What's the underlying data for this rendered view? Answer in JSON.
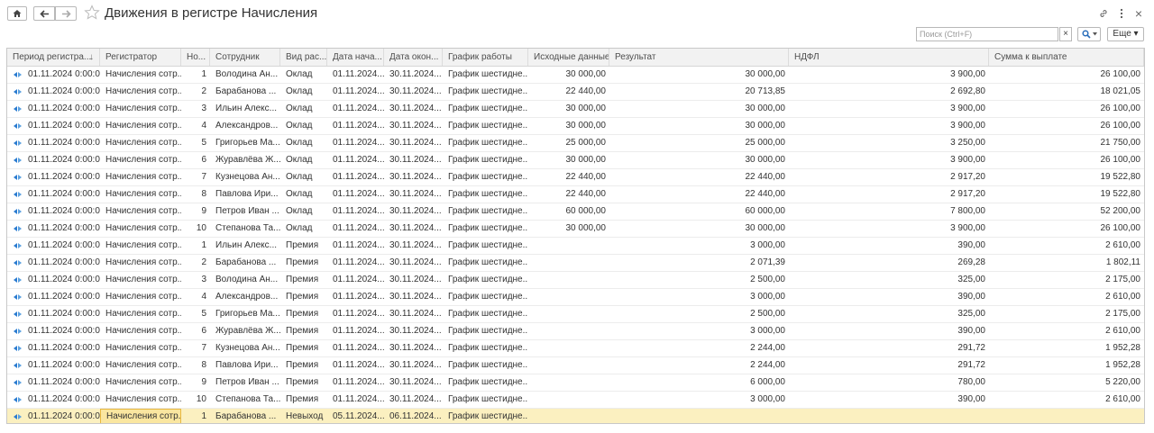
{
  "window": {
    "title": "Движения в регистре Начисления",
    "home_icon": "home-icon",
    "back_icon": "arrow-left-icon",
    "forward_icon": "arrow-right-icon",
    "favorite_icon": "star-icon",
    "link_icon": "link-icon",
    "menu_icon": "more-vertical-icon",
    "close_label": "×"
  },
  "toolbar": {
    "search_placeholder": "Поиск (Ctrl+F)",
    "clear_label": "×",
    "more_label": "Еще",
    "more_arrow": "▾"
  },
  "table": {
    "columns": [
      "Период регистра...",
      "Регистратор",
      "Но...",
      "Сотрудник",
      "Вид рас...",
      "Дата нача...",
      "Дата окон...",
      "График работы",
      "Исходные данные",
      "Результат",
      "НДФЛ",
      "Сумма к выплате"
    ],
    "sort_indicator": "↓",
    "rows": [
      [
        "01.11.2024 0:00:00",
        "Начисления сотр...",
        "1",
        "Володина Ан...",
        "Оклад",
        "01.11.2024...",
        "30.11.2024...",
        "График шестидне...",
        "30 000,00",
        "30 000,00",
        "3 900,00",
        "26 100,00"
      ],
      [
        "01.11.2024 0:00:00",
        "Начисления сотр...",
        "2",
        "Барабанова ...",
        "Оклад",
        "01.11.2024...",
        "30.11.2024...",
        "График шестидне...",
        "22 440,00",
        "20 713,85",
        "2 692,80",
        "18 021,05"
      ],
      [
        "01.11.2024 0:00:00",
        "Начисления сотр...",
        "3",
        "Ильин Алекс...",
        "Оклад",
        "01.11.2024...",
        "30.11.2024...",
        "График шестидне...",
        "30 000,00",
        "30 000,00",
        "3 900,00",
        "26 100,00"
      ],
      [
        "01.11.2024 0:00:00",
        "Начисления сотр...",
        "4",
        "Александров...",
        "Оклад",
        "01.11.2024...",
        "30.11.2024...",
        "График шестидне...",
        "30 000,00",
        "30 000,00",
        "3 900,00",
        "26 100,00"
      ],
      [
        "01.11.2024 0:00:00",
        "Начисления сотр...",
        "5",
        "Григорьев Ма...",
        "Оклад",
        "01.11.2024...",
        "30.11.2024...",
        "График шестидне...",
        "25 000,00",
        "25 000,00",
        "3 250,00",
        "21 750,00"
      ],
      [
        "01.11.2024 0:00:00",
        "Начисления сотр...",
        "6",
        "Журавлёва Ж...",
        "Оклад",
        "01.11.2024...",
        "30.11.2024...",
        "График шестидне...",
        "30 000,00",
        "30 000,00",
        "3 900,00",
        "26 100,00"
      ],
      [
        "01.11.2024 0:00:00",
        "Начисления сотр...",
        "7",
        "Кузнецова Ан...",
        "Оклад",
        "01.11.2024...",
        "30.11.2024...",
        "График шестидне...",
        "22 440,00",
        "22 440,00",
        "2 917,20",
        "19 522,80"
      ],
      [
        "01.11.2024 0:00:00",
        "Начисления сотр...",
        "8",
        "Павлова Ири...",
        "Оклад",
        "01.11.2024...",
        "30.11.2024...",
        "График шестидне...",
        "22 440,00",
        "22 440,00",
        "2 917,20",
        "19 522,80"
      ],
      [
        "01.11.2024 0:00:00",
        "Начисления сотр...",
        "9",
        "Петров Иван ...",
        "Оклад",
        "01.11.2024...",
        "30.11.2024...",
        "График шестидне...",
        "60 000,00",
        "60 000,00",
        "7 800,00",
        "52 200,00"
      ],
      [
        "01.11.2024 0:00:00",
        "Начисления сотр...",
        "10",
        "Степанова Та...",
        "Оклад",
        "01.11.2024...",
        "30.11.2024...",
        "График шестидне...",
        "30 000,00",
        "30 000,00",
        "3 900,00",
        "26 100,00"
      ],
      [
        "01.11.2024 0:00:00",
        "Начисления сотр...",
        "1",
        "Ильин Алекс...",
        "Премия",
        "01.11.2024...",
        "30.11.2024...",
        "График шестидне...",
        "",
        "3 000,00",
        "390,00",
        "2 610,00"
      ],
      [
        "01.11.2024 0:00:00",
        "Начисления сотр...",
        "2",
        "Барабанова ...",
        "Премия",
        "01.11.2024...",
        "30.11.2024...",
        "График шестидне...",
        "",
        "2 071,39",
        "269,28",
        "1 802,11"
      ],
      [
        "01.11.2024 0:00:00",
        "Начисления сотр...",
        "3",
        "Володина Ан...",
        "Премия",
        "01.11.2024...",
        "30.11.2024...",
        "График шестидне...",
        "",
        "2 500,00",
        "325,00",
        "2 175,00"
      ],
      [
        "01.11.2024 0:00:00",
        "Начисления сотр...",
        "4",
        "Александров...",
        "Премия",
        "01.11.2024...",
        "30.11.2024...",
        "График шестидне...",
        "",
        "3 000,00",
        "390,00",
        "2 610,00"
      ],
      [
        "01.11.2024 0:00:00",
        "Начисления сотр...",
        "5",
        "Григорьев Ма...",
        "Премия",
        "01.11.2024...",
        "30.11.2024...",
        "График шестидне...",
        "",
        "2 500,00",
        "325,00",
        "2 175,00"
      ],
      [
        "01.11.2024 0:00:00",
        "Начисления сотр...",
        "6",
        "Журавлёва Ж...",
        "Премия",
        "01.11.2024...",
        "30.11.2024...",
        "График шестидне...",
        "",
        "3 000,00",
        "390,00",
        "2 610,00"
      ],
      [
        "01.11.2024 0:00:00",
        "Начисления сотр...",
        "7",
        "Кузнецова Ан...",
        "Премия",
        "01.11.2024...",
        "30.11.2024...",
        "График шестидне...",
        "",
        "2 244,00",
        "291,72",
        "1 952,28"
      ],
      [
        "01.11.2024 0:00:00",
        "Начисления сотр...",
        "8",
        "Павлова Ири...",
        "Премия",
        "01.11.2024...",
        "30.11.2024...",
        "График шестидне...",
        "",
        "2 244,00",
        "291,72",
        "1 952,28"
      ],
      [
        "01.11.2024 0:00:00",
        "Начисления сотр...",
        "9",
        "Петров Иван ...",
        "Премия",
        "01.11.2024...",
        "30.11.2024...",
        "График шестидне...",
        "",
        "6 000,00",
        "780,00",
        "5 220,00"
      ],
      [
        "01.11.2024 0:00:00",
        "Начисления сотр...",
        "10",
        "Степанова Та...",
        "Премия",
        "01.11.2024...",
        "30.11.2024...",
        "График шестидне...",
        "",
        "3 000,00",
        "390,00",
        "2 610,00"
      ],
      [
        "01.11.2024 0:00:00",
        "Начисления сотр...",
        "1",
        "Барабанова ...",
        "Невыход",
        "05.11.2024...",
        "06.11.2024...",
        "График шестидне...",
        "",
        "",
        "",
        ""
      ]
    ],
    "selected_row": 20,
    "row_icon": "record-move-icon",
    "colors": {
      "header_bg": "#f2f2f2",
      "selected_bg": "#fbf0c0",
      "focus_border": "#e8b840"
    }
  }
}
